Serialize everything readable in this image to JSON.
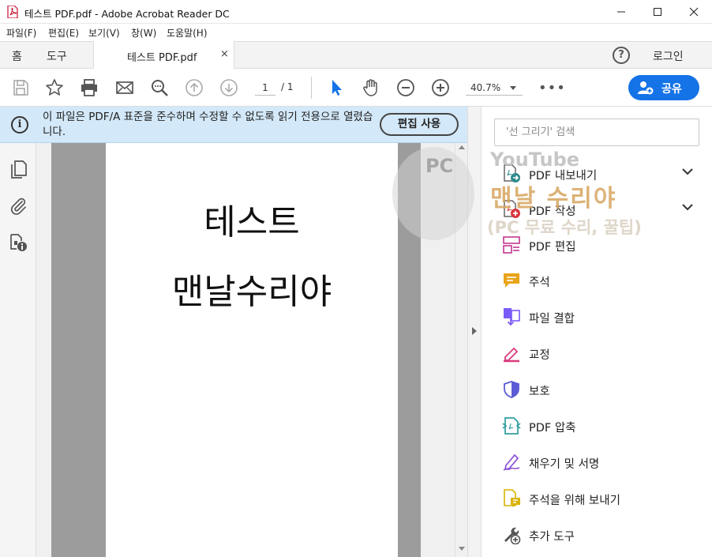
{
  "window": {
    "title": "테스트 PDF.pdf - Adobe Acrobat Reader DC"
  },
  "menu": [
    "파일(F)",
    "편집(E)",
    "보기(V)",
    "창(W)",
    "도움말(H)"
  ],
  "tabs": {
    "home": "홈",
    "tools": "도구",
    "document": "테스트 PDF.pdf",
    "close": "×",
    "help": "?",
    "login": "로그인"
  },
  "toolbar": {
    "page_current": "1",
    "page_total": "/ 1",
    "zoom": "40.7%",
    "more": "•••",
    "share_label": "공유"
  },
  "infobar": {
    "icon": "i",
    "message": "이 파일은 PDF/A 표준을 준수하며 수정할 수 없도록 읽기 전용으로 열렸습니다.",
    "button": "편집 사용"
  },
  "document": {
    "line1": "테스트",
    "line2": "맨날수리야"
  },
  "right_panel": {
    "search_placeholder": "'선 그리기' 검색",
    "tools": [
      {
        "label": "PDF 내보내기",
        "icon": "export-pdf-icon",
        "expandable": true
      },
      {
        "label": "PDF 작성",
        "icon": "create-pdf-icon",
        "expandable": true
      },
      {
        "label": "PDF 편집",
        "icon": "edit-pdf-icon",
        "expandable": false
      },
      {
        "label": "주석",
        "icon": "comment-icon",
        "expandable": false
      },
      {
        "label": "파일 결합",
        "icon": "combine-files-icon",
        "expandable": false
      },
      {
        "label": "교정",
        "icon": "redact-icon",
        "expandable": false
      },
      {
        "label": "보호",
        "icon": "protect-icon",
        "expandable": false
      },
      {
        "label": "PDF 압축",
        "icon": "compress-pdf-icon",
        "expandable": false
      },
      {
        "label": "채우기 및 서명",
        "icon": "fill-sign-icon",
        "expandable": false
      },
      {
        "label": "주석을 위해 보내기",
        "icon": "send-comments-icon",
        "expandable": false
      },
      {
        "label": "추가 도구",
        "icon": "more-tools-icon",
        "expandable": false
      }
    ]
  },
  "watermark": {
    "youtube": "YouTube",
    "brand": "맨날 수리야",
    "subtitle": "(PC 무료 수리, 꿀팁)",
    "badge": "PC"
  },
  "colors": {
    "accent": "#1473e6",
    "infobar": "#d3e8f8",
    "pointer_tool": "#1473e6"
  }
}
